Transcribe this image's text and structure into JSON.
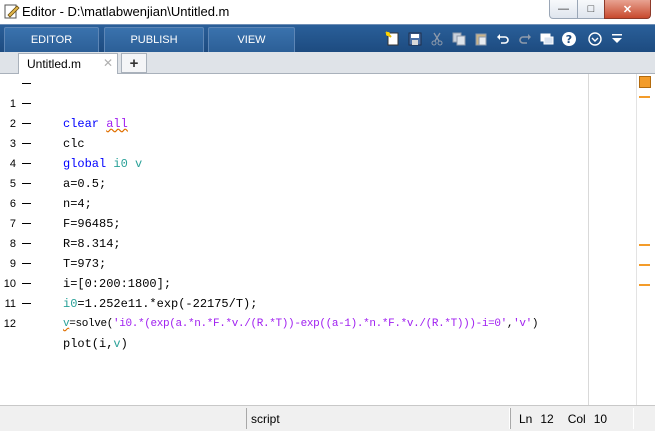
{
  "window": {
    "title": "Editor - D:\\matlabwenjian\\Untitled.m",
    "min_label": "—",
    "max_label": "□",
    "close_label": "✕"
  },
  "toolstrip": {
    "tabs": [
      {
        "label": "EDITOR"
      },
      {
        "label": "PUBLISH"
      },
      {
        "label": "VIEW"
      }
    ],
    "icons": [
      "new-file-icon",
      "save-icon",
      "cut-icon",
      "copy-icon",
      "paste-icon",
      "undo-icon",
      "redo-icon",
      "switch-windows-icon",
      "help-icon",
      "expand-options-icon",
      "dropdown-icon"
    ]
  },
  "documents": {
    "tabs": [
      {
        "label": "Untitled.m",
        "close": "✕"
      }
    ],
    "add_label": "+"
  },
  "code": {
    "lines": [
      {
        "n": "1",
        "text": "clear all"
      },
      {
        "n": "2",
        "text": "clc"
      },
      {
        "n": "3",
        "text": "global i0 v"
      },
      {
        "n": "4",
        "text": "a=0.5;"
      },
      {
        "n": "5",
        "text": "n=4;"
      },
      {
        "n": "6",
        "text": "F=96485;"
      },
      {
        "n": "7",
        "text": "R=8.314;"
      },
      {
        "n": "8",
        "text": "T=973;"
      },
      {
        "n": "9",
        "text": "i=[0:200:1800];"
      },
      {
        "n": "10",
        "text": "i0=1.252e11.*exp(-22175/T);"
      },
      {
        "n": "11",
        "text": "v=solve('i0.*(exp(a.*n.*F.*v./(R.*T))-exp((a-1).*n.*F.*v./(R.*T)))-i=0','v')"
      },
      {
        "n": "12",
        "text": "plot(i,v)"
      }
    ],
    "tokens": {
      "l1_kw": "clear",
      "l1_arg": "all",
      "l2": "clc",
      "l3_kw": "global",
      "l3_vars": "i0 v",
      "l4": "a=0.5;",
      "l5": "n=4;",
      "l6": "F=96485;",
      "l7": "R=8.314;",
      "l8": "T=973;",
      "l9": "i=[0:200:1800];",
      "l10_var": "i0",
      "l10_rest": "=1.252e11.*exp(-22175/T);",
      "l11_var": "v",
      "l11_mid": "=solve(",
      "l11_str1": "'i0.*(exp(a.*n.*F.*v./(R.*T))-exp((a-1).*n.*F.*v./(R.*T)))-i=0'",
      "l11_comma": ",",
      "l11_str2": "'v'",
      "l11_end": ")",
      "l12_a": "plot(i,",
      "l12_var": "v",
      "l12_b": ")"
    }
  },
  "status": {
    "mode": "script",
    "ln_label": "Ln",
    "ln_value": "12",
    "col_label": "Col",
    "col_value": "10"
  },
  "colors": {
    "toolstrip": "#1d4b80",
    "keyword": "#0000ff",
    "string": "#a020f0",
    "global_var": "#2aa198",
    "warning": "#f39c2a"
  }
}
